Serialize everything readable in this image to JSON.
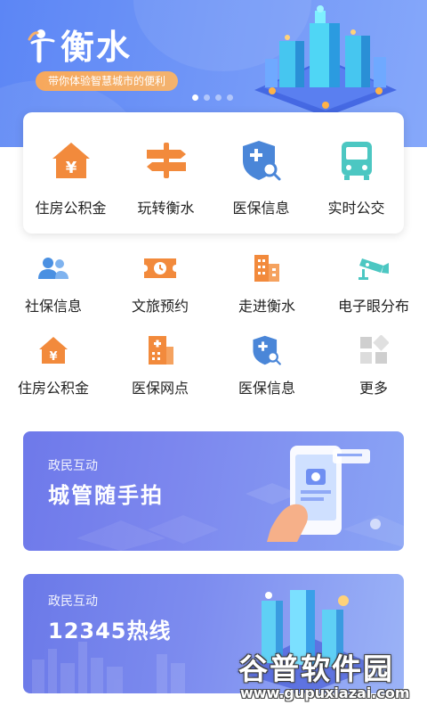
{
  "hero": {
    "title": "衡水",
    "slogan": "带你体验智慧城市的便利",
    "dots": 4,
    "active_dot": 0,
    "bg_color": "#6f95f7"
  },
  "main_card": [
    {
      "label": "住房公积金",
      "icon": "house-yuan-icon",
      "color": "#f28a3c"
    },
    {
      "label": "玩转衡水",
      "icon": "signpost-icon",
      "color": "#f28a3c"
    },
    {
      "label": "医保信息",
      "icon": "medical-shield-icon",
      "color": "#4a86d8"
    },
    {
      "label": "实时公交",
      "icon": "bus-icon",
      "color": "#4cc7c2"
    }
  ],
  "service_grid": [
    [
      {
        "label": "社保信息",
        "icon": "people-icon",
        "color": "#4a90e2"
      },
      {
        "label": "文旅预约",
        "icon": "ticket-clock-icon",
        "color": "#f28a3c"
      },
      {
        "label": "走进衡水",
        "icon": "buildings-icon",
        "color": "#f28a3c"
      },
      {
        "label": "电子眼分布",
        "icon": "camera-icon",
        "color": "#4cc7c2"
      }
    ],
    [
      {
        "label": "住房公积金",
        "icon": "house-yuan-icon",
        "color": "#f28a3c"
      },
      {
        "label": "医保网点",
        "icon": "hospital-icon",
        "color": "#f28a3c"
      },
      {
        "label": "医保信息",
        "icon": "medical-shield-icon",
        "color": "#4a86d8"
      },
      {
        "label": "更多",
        "icon": "more-grid-icon",
        "color": "#c8c8c8"
      }
    ]
  ],
  "banners": [
    {
      "subtitle": "政民互动",
      "title": "城管随手拍"
    },
    {
      "subtitle": "政民互动",
      "title": "12345热线"
    }
  ],
  "watermark": {
    "name": "谷普软件园",
    "url": "www.gupuxiazai.com"
  }
}
